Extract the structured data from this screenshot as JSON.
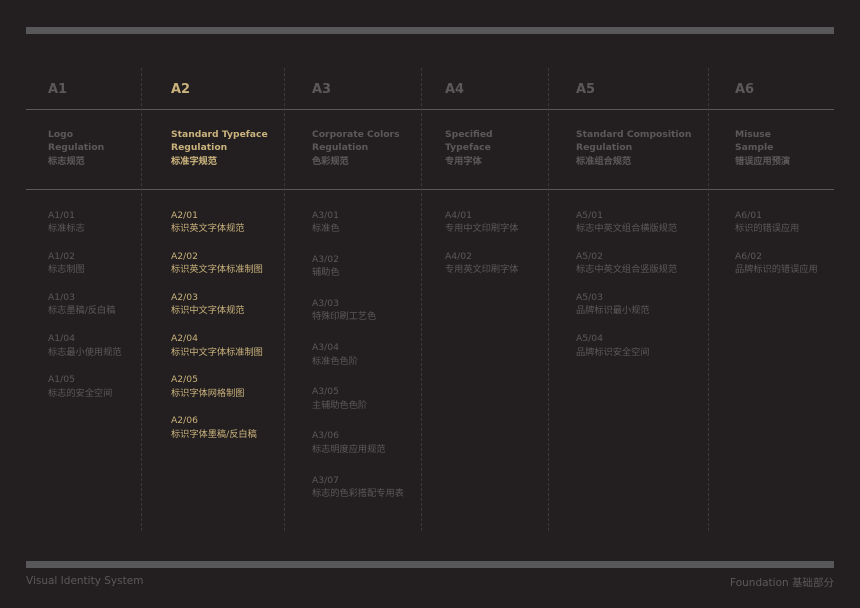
{
  "columns": [
    {
      "code": "A1",
      "title": [
        "Logo",
        "Regulation",
        "标志规范"
      ],
      "items": [
        [
          "A1/01",
          "标准标志"
        ],
        [
          "A1/02",
          "标志制图"
        ],
        [
          "A1/03",
          "标志墨稿/反白稿"
        ],
        [
          "A1/04",
          "标志最小使用规范"
        ],
        [
          "A1/05",
          "标志的安全空间"
        ]
      ]
    },
    {
      "code": "A2",
      "active": true,
      "title": [
        "Standard Typeface",
        "Regulation",
        "标准字规范"
      ],
      "items": [
        [
          "A2/01",
          "标识英文字体规范"
        ],
        [
          "A2/02",
          "标识英文字体标准制图"
        ],
        [
          "A2/03",
          "标识中文字体规范"
        ],
        [
          "A2/04",
          "标识中文字体标准制图"
        ],
        [
          "A2/05",
          "标识字体网格制图"
        ],
        [
          "A2/06",
          "标识字体墨稿/反白稿"
        ]
      ]
    },
    {
      "code": "A3",
      "title": [
        "Corporate Colors",
        "Regulation",
        "色彩规范"
      ],
      "items": [
        [
          "A3/01",
          "标准色"
        ],
        [
          "A3/02",
          "辅助色"
        ],
        [
          "A3/03",
          "特殊印刷工艺色"
        ],
        [
          "A3/04",
          "标准色色阶"
        ],
        [
          "A3/05",
          "主辅助色色阶"
        ],
        [
          "A3/06",
          "标志明度应用规范"
        ],
        [
          "A3/07",
          "标志的色彩搭配专用表"
        ]
      ]
    },
    {
      "code": "A4",
      "title": [
        "Specified",
        "Typeface",
        "专用字体"
      ],
      "items": [
        [
          "A4/01",
          "专用中文印刷字体"
        ],
        [
          "A4/02",
          "专用英文印刷字体"
        ]
      ]
    },
    {
      "code": "A5",
      "title": [
        "Standard Composition",
        "Regulation",
        "标准组合规范"
      ],
      "items": [
        [
          "A5/01",
          "标志中英文组合横版规范"
        ],
        [
          "A5/02",
          "标志中英文组合竖版规范"
        ],
        [
          "A5/03",
          "品牌标识最小规范"
        ],
        [
          "A5/04",
          "品牌标识安全空间"
        ]
      ]
    },
    {
      "code": "A6",
      "title": [
        "Misuse",
        "Sample",
        "错误应用预演"
      ],
      "items": [
        [
          "A6/01",
          "标识的错误应用"
        ],
        [
          "A6/02",
          "品牌标识的错误应用"
        ]
      ]
    }
  ],
  "footer": {
    "left": "Visual Identity System",
    "right": "Foundation  基础部分"
  }
}
